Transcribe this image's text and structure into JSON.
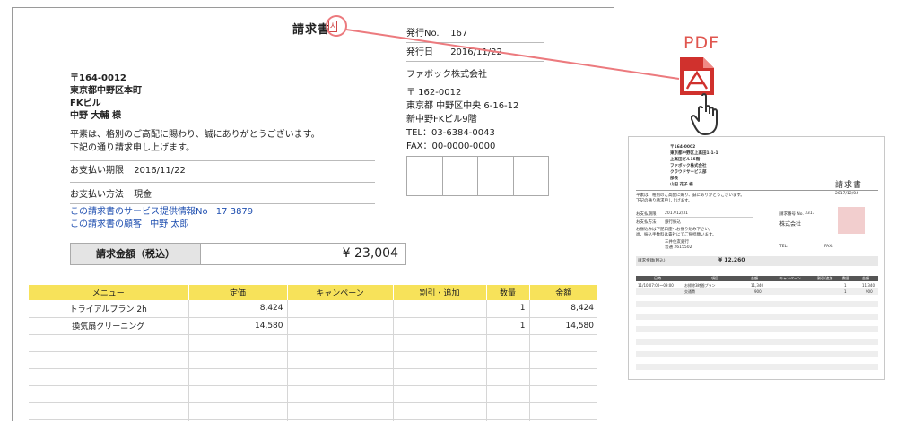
{
  "invoice": {
    "title": "請求書",
    "pdf_mark": "人",
    "issue_no_label": "発行No.",
    "issue_no": "167",
    "issue_date_label": "発行日",
    "issue_date": "2016/11/22",
    "recipient": {
      "postal": "〒164-0012",
      "address": "東京都中野区本町",
      "building": "FKビル",
      "name": "中野 大輔 様"
    },
    "greeting_1": "平素は、格別のご高配に賜わり、誠にありがとうございます。",
    "greeting_2": "下記の通り請求申し上げます。",
    "due_label": "お支払い期限",
    "due_date": "2016/11/22",
    "payment_label": "お支払い方法",
    "payment_method": "現金",
    "service_label": "この請求書のサービス提供情報No",
    "service_no": "17 3879",
    "customer_label": "この請求書の顧客",
    "customer_name": "中野 太郎",
    "issuer": {
      "company": "ファボック株式会社",
      "postal": "〒 162-0012",
      "address": "東京都 中野区中央 6-16-12",
      "building": "新中野FKビル9階",
      "tel": "TEL：03-6384-0043",
      "fax": "FAX：00-0000-0000"
    },
    "total_label": "請求金額（税込）",
    "total_value": "¥ 23,004",
    "table": {
      "headers": [
        "メニュー",
        "定価",
        "キャンペーン",
        "割引・追加",
        "数量",
        "金額"
      ],
      "rows": [
        [
          "トライアルプラン 2h",
          "8,424",
          "",
          "",
          "1",
          "8,424"
        ],
        [
          "換気扇クリーニング",
          "14,580",
          "",
          "",
          "1",
          "14,580"
        ]
      ]
    }
  },
  "pdf_label": "PDF",
  "preview": {
    "postal": "〒164-0002",
    "address": "東京都中野区上高田1-1-1",
    "building": "上高田ビル15階",
    "company": "ファボック株式会社",
    "service": "クラウドサービス部",
    "dept": "部長",
    "person": "山田 花子 様",
    "title": "請求書",
    "issue_date": "2017/12/04",
    "greeting_1": "平素は、格別のご高配に賜り、誠にありがとうございます。",
    "greeting_2": "下記の通り請求申し上げます。",
    "issue_no_label": "請求番号 No.",
    "issue_no": "3317",
    "issuer_company": "株式会社",
    "due_label": "お支払期限",
    "due_date": "2017/12/31",
    "payment_label": "お支払方法",
    "payment": "銀行振込",
    "note_1": "お振込みは下記口座へお振り込み下さい。",
    "note_2": "尚、振込手数料は貴社にてご負担願います。",
    "bank": "三井住友銀行",
    "account": "普通 2615502",
    "tel": "TEL:",
    "fax": "FAX:",
    "total_label": "請求金額(税込)",
    "total_value": "¥ 12,260",
    "headers": [
      "日時",
      "項目",
      "金額",
      "キャンペーン",
      "割引/追加",
      "数量",
      "金額"
    ],
    "row_1": [
      "11/10 07:00〜09:00",
      "お掃除3時間プラン",
      "11,340",
      "",
      "",
      "1",
      "11,340"
    ],
    "row_2": [
      "",
      "交通費",
      "900",
      "",
      "",
      "1",
      "900"
    ]
  },
  "colors": {
    "table_header": "#f7e25a",
    "link": "#1f4fb0",
    "accent": "#e0564f",
    "pdf_red": "#d0312d"
  }
}
